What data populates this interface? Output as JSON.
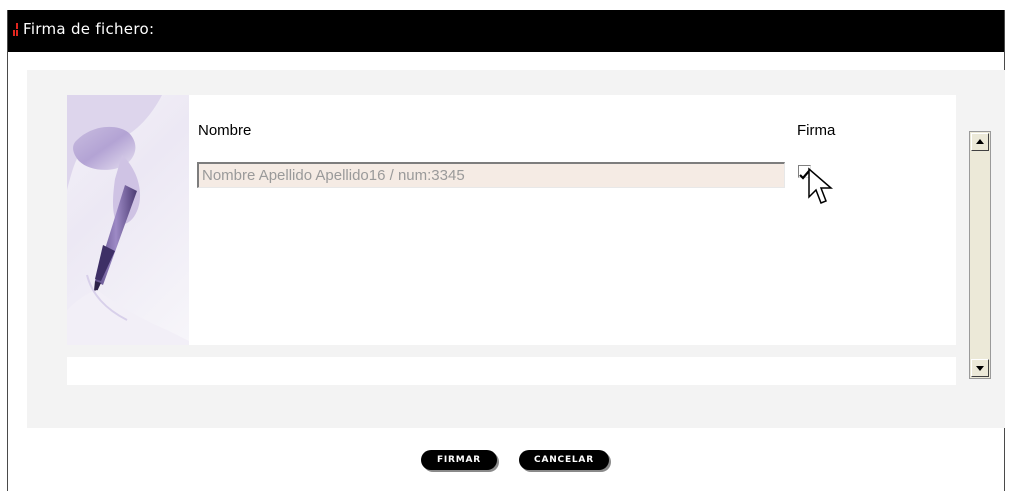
{
  "window": {
    "title": "Firma de fichero:"
  },
  "table": {
    "columns": {
      "name_header": "Nombre",
      "sign_header": "Firma"
    },
    "rows": [
      {
        "name": "Nombre Apellido Apellido16 / num:3345",
        "signed": true
      }
    ]
  },
  "buttons": {
    "sign_label": "FIRMAR",
    "cancel_label": "CANCELAR"
  },
  "icons": {
    "title_marker": "red-exclamation-icon",
    "scroll_up": "arrow-up-icon",
    "scroll_down": "arrow-down-icon",
    "checkbox": "checkmark-icon",
    "cursor": "mouse-pointer-icon"
  },
  "colors": {
    "titlebar_bg": "#000000",
    "title_marker": "#e0261f",
    "field_bg": "#f5ebe4",
    "panel_bg": "#f3f3f3"
  }
}
